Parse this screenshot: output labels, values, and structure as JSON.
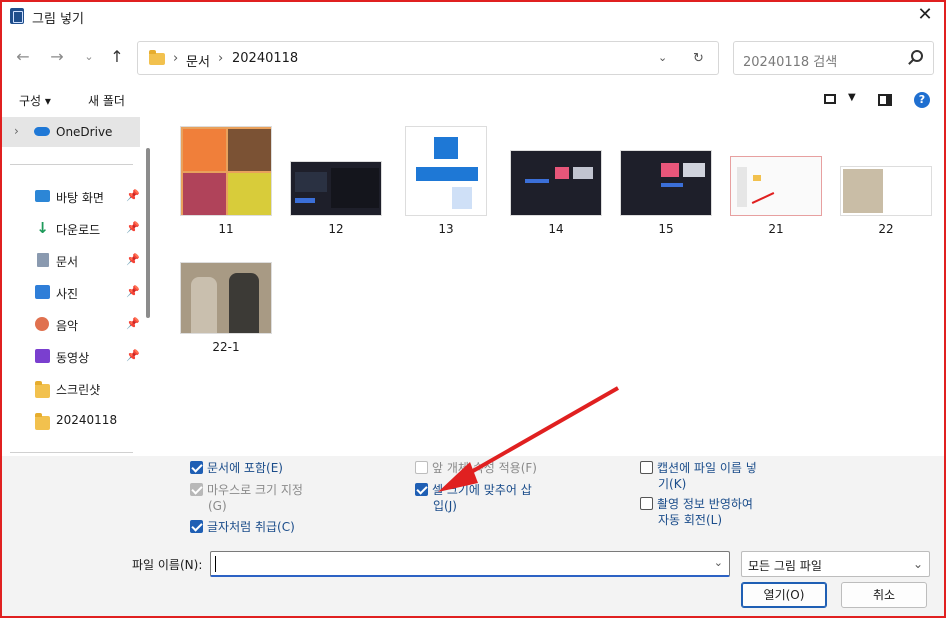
{
  "window": {
    "title": "그림 넣기"
  },
  "address": {
    "crumbs": [
      "문서",
      "20240118"
    ]
  },
  "search": {
    "placeholder": "20240118 검색"
  },
  "toolbar": {
    "organize": "구성 ▾",
    "new_folder": "새 폴더"
  },
  "sidebar": {
    "onedrive": "OneDrive",
    "items": [
      {
        "label": "바탕 화면",
        "icon": "desktop-icon",
        "pinned": true
      },
      {
        "label": "다운로드",
        "icon": "download-icon",
        "pinned": true
      },
      {
        "label": "문서",
        "icon": "document-icon",
        "pinned": true
      },
      {
        "label": "사진",
        "icon": "pictures-icon",
        "pinned": true
      },
      {
        "label": "음악",
        "icon": "music-icon",
        "pinned": true
      },
      {
        "label": "동영상",
        "icon": "video-icon",
        "pinned": true
      },
      {
        "label": "스크린샷",
        "icon": "folder-icon",
        "pinned": false
      },
      {
        "label": "20240118",
        "icon": "folder-icon",
        "pinned": false
      }
    ]
  },
  "files": [
    "11",
    "12",
    "13",
    "14",
    "15",
    "21",
    "22",
    "22-1"
  ],
  "options": {
    "include_doc": "문서에 포함(E)",
    "mouse_size_1": "마우스로 크기 지정",
    "mouse_size_2": "(G)",
    "as_char": "글자처럼 취급(C)",
    "prev_attr": "앞 개체 속성 적용(F)",
    "cell_fit_1": "셀 크기에 맞추어 삽",
    "cell_fit_2": "입(J)",
    "caption_1": "캡션에 파일 이름 넣",
    "caption_2": "기(K)",
    "exif_1": "촬영 정보 반영하여",
    "exif_2": "자동 회전(L)"
  },
  "footer": {
    "filename_label": "파일 이름(N):",
    "filename_value": "",
    "filter": "모든 그림 파일",
    "open": "열기(O)",
    "cancel": "취소"
  },
  "colors": {
    "accent": "#1f5fb4",
    "frame": "#e02020",
    "arrow": "#e02020"
  }
}
